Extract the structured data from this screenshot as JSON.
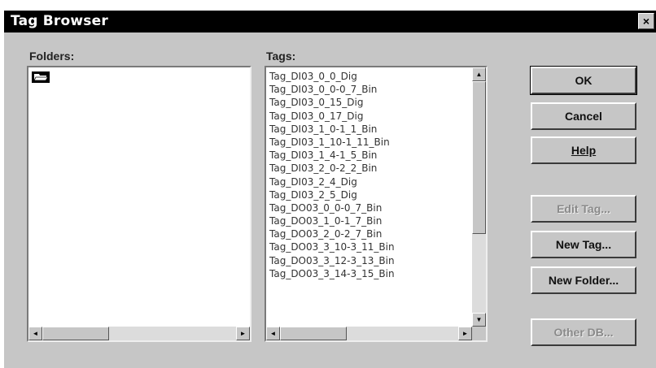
{
  "window": {
    "title": "Tag Browser",
    "close_glyph": "×"
  },
  "folders": {
    "label": "Folders:",
    "items": [
      {
        "icon": "open-folder-icon"
      }
    ]
  },
  "tags": {
    "label": "Tags:",
    "items": [
      "Tag_DI03_0_0_Dig",
      "Tag_DI03_0_0-0_7_Bin",
      "Tag_DI03_0_15_Dig",
      "Tag_DI03_0_17_Dig",
      "Tag_DI03_1_0-1_1_Bin",
      "Tag_DI03_1_10-1_11_Bin",
      "Tag_DI03_1_4-1_5_Bin",
      "Tag_DI03_2_0-2_2_Bin",
      "Tag_DI03_2_4_Dig",
      "Tag_DI03_2_5_Dig",
      "Tag_DO03_0_0-0_7_Bin",
      "Tag_DO03_1_0-1_7_Bin",
      "Tag_DO03_2_0-2_7_Bin",
      "Tag_DO03_3_10-3_11_Bin",
      "Tag_DO03_3_12-3_13_Bin",
      "Tag_DO03_3_14-3_15_Bin"
    ]
  },
  "buttons": {
    "ok": "OK",
    "cancel": "Cancel",
    "help": "Help",
    "edit_tag": "Edit Tag...",
    "new_tag": "New Tag...",
    "new_folder": "New Folder...",
    "other_db": "Other DB..."
  },
  "scroll": {
    "left_arrow": "◄",
    "right_arrow": "►",
    "up_arrow": "▲",
    "down_arrow": "▼"
  },
  "colors": {
    "dialog_bg": "#c6c6c6",
    "titlebar": "#000000",
    "title_text": "#ffffff"
  }
}
